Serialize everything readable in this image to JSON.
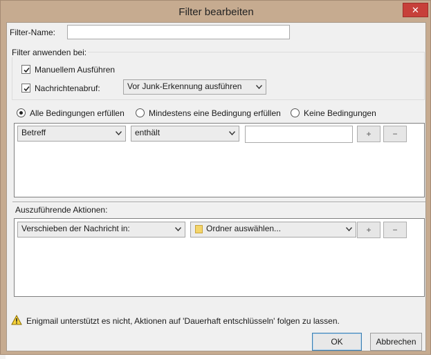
{
  "window": {
    "title": "Filter bearbeiten",
    "close_glyph": "✕"
  },
  "filter_name": {
    "label": "Filter-Name:",
    "value": ""
  },
  "apply_group": {
    "legend": "Filter anwenden bei:",
    "manual": {
      "label": "Manuellem Ausführen",
      "checked": true
    },
    "fetch": {
      "label": "Nachrichtenabruf:",
      "checked": true,
      "select_value": "Vor Junk-Erkennung ausführen"
    }
  },
  "match": {
    "all": "Alle Bedingungen erfüllen",
    "any": "Mindestens eine Bedingung erfüllen",
    "none": "Keine Bedingungen",
    "selected": "all"
  },
  "condition": {
    "field": "Betreff",
    "operator": "enthält",
    "value": "",
    "add_label": "+",
    "remove_label": "−"
  },
  "actions": {
    "legend": "Auszuführende Aktionen:",
    "action": "Verschieben der Nachricht in:",
    "target": "Ordner auswählen...",
    "add_label": "+",
    "remove_label": "−"
  },
  "warning": {
    "text": "Enigmail unterstützt es nicht, Aktionen auf 'Dauerhaft entschlüsseln' folgen zu lassen."
  },
  "buttons": {
    "ok": "OK",
    "cancel": "Abbrechen"
  },
  "icons": {
    "checkbox": "checkmark-icon",
    "dropdown": "chevron-down-icon",
    "warning": "warning-triangle-icon",
    "folder": "folder-icon"
  }
}
